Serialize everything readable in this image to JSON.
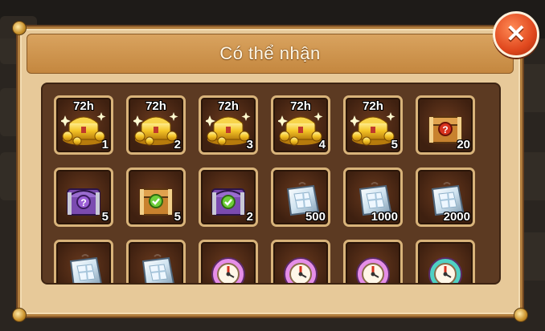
{
  "dialog": {
    "title": "Có thể nhận"
  },
  "close_button": {
    "icon": "close-icon"
  },
  "items": [
    {
      "icon": "gold-chest-icon",
      "timer": "72h",
      "count": "1"
    },
    {
      "icon": "gold-chest-icon",
      "timer": "72h",
      "count": "2"
    },
    {
      "icon": "gold-chest-icon",
      "timer": "72h",
      "count": "3"
    },
    {
      "icon": "gold-chest-icon",
      "timer": "72h",
      "count": "4"
    },
    {
      "icon": "gold-chest-icon",
      "timer": "72h",
      "count": "5"
    },
    {
      "icon": "mystery-wooden-chest-icon",
      "timer": "",
      "count": "20"
    },
    {
      "icon": "mystery-purple-chest-icon",
      "timer": "",
      "count": "5"
    },
    {
      "icon": "checked-wooden-chest-icon",
      "timer": "",
      "count": "5"
    },
    {
      "icon": "checked-purple-chest-icon",
      "timer": "",
      "count": "2"
    },
    {
      "icon": "silver-crystal-pack-icon",
      "timer": "",
      "count": "500"
    },
    {
      "icon": "silver-crystal-pack-icon",
      "timer": "",
      "count": "1000"
    },
    {
      "icon": "silver-crystal-pack-icon",
      "timer": "",
      "count": "2000"
    },
    {
      "icon": "silver-crystal-pack-icon",
      "timer": "",
      "count": ""
    },
    {
      "icon": "silver-crystal-pack-icon",
      "timer": "",
      "count": ""
    },
    {
      "icon": "pink-clock-token-icon",
      "timer": "",
      "count": ""
    },
    {
      "icon": "pink-clock-token-icon",
      "timer": "",
      "count": ""
    },
    {
      "icon": "pink-clock-token-icon",
      "timer": "",
      "count": ""
    },
    {
      "icon": "cyan-clock-token-icon",
      "timer": "",
      "count": ""
    }
  ],
  "colors": {
    "gold": "#f5c526",
    "purple": "#7b4bb0",
    "wood": "#c8822e",
    "silver": "#cfe3f0",
    "pink": "#e58ee8",
    "cyan": "#4fd1c4",
    "check": "#6fcf3a",
    "question": "#d8321e"
  }
}
